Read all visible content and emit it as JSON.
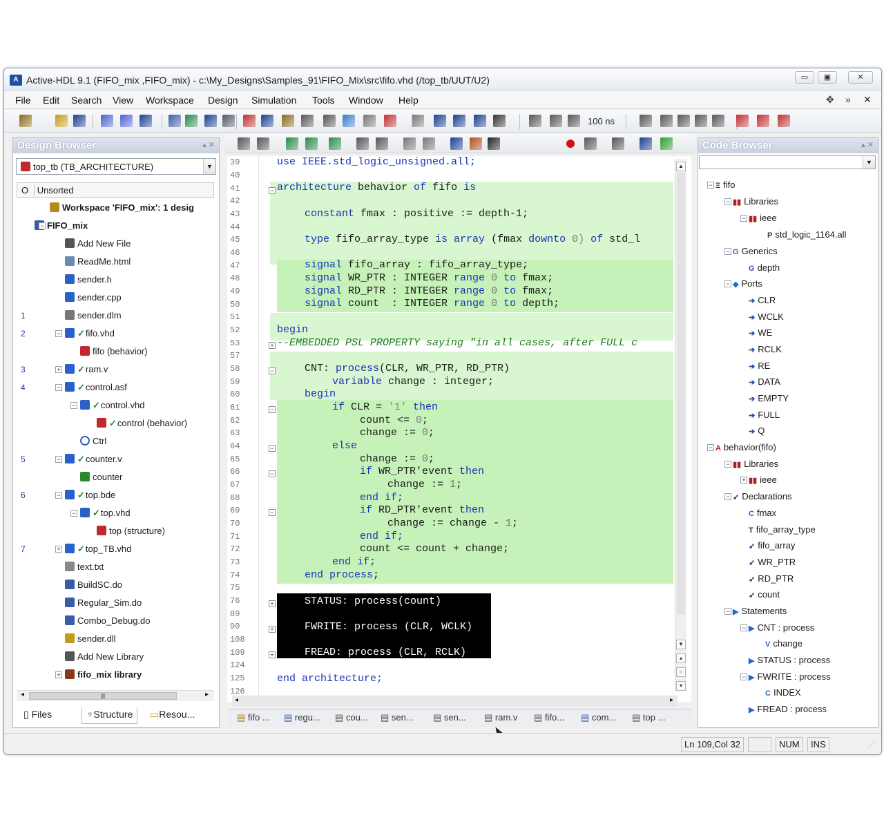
{
  "window": {
    "title": "Active-HDL 9.1 (FIFO_mix ,FIFO_mix) - c:\\My_Designs\\Samples_91\\FIFO_Mix\\src\\fifo.vhd (/top_tb/UUT/U2)",
    "controls": {
      "minimize": "▭",
      "maximize": "▣",
      "close": "✕"
    }
  },
  "menu": {
    "items": [
      "File",
      "Edit",
      "Search",
      "View",
      "Workspace",
      "Design",
      "Simulation",
      "Tools",
      "Window",
      "Help"
    ],
    "right": [
      "✥",
      "»",
      "✕"
    ]
  },
  "toolbar": {
    "sim_time": "100 ns",
    "icons": [
      "new-icon",
      "open-icon",
      "save-icon",
      "compile-icon",
      "compile-all-icon",
      "stop-compile-icon",
      "design-browser-icon",
      "hierarchy-icon",
      "console-icon",
      "find-icon",
      "waveform-icon",
      "statemachine-icon",
      "library-icon",
      "memory-icon",
      "wizard-icon",
      "watch-icon",
      "list-icon",
      "breakpoint-icon",
      "bookmark-icon",
      "run-icon",
      "run-until-icon",
      "step-icon",
      "restart-icon",
      "end-sim-icon",
      "step-back-icon",
      "step-forward-icon"
    ]
  },
  "design_browser": {
    "title": "Design Browser",
    "combo": "top_tb (TB_ARCHITECTURE)",
    "sort": "Unsorted",
    "sort_col": "O",
    "items": [
      {
        "label": "Workspace 'FIFO_mix': 1 desig",
        "bold": true,
        "num": ""
      },
      {
        "label": "FIFO_mix",
        "bold": true,
        "num": ""
      },
      {
        "label": "Add New File",
        "bold": false,
        "num": ""
      },
      {
        "label": "ReadMe.html",
        "bold": false,
        "num": ""
      },
      {
        "label": "sender.h",
        "bold": false,
        "num": ""
      },
      {
        "label": "sender.cpp",
        "bold": false,
        "num": ""
      },
      {
        "label": "sender.dlm",
        "bold": false,
        "num": "1"
      },
      {
        "label": "fifo.vhd",
        "bold": false,
        "num": "2"
      },
      {
        "label": "fifo (behavior)",
        "bold": false,
        "num": ""
      },
      {
        "label": "ram.v",
        "bold": false,
        "num": "3"
      },
      {
        "label": "control.asf",
        "bold": false,
        "num": "4"
      },
      {
        "label": "control.vhd",
        "bold": false,
        "num": ""
      },
      {
        "label": "control (behavior)",
        "bold": false,
        "num": ""
      },
      {
        "label": "Ctrl",
        "bold": false,
        "num": ""
      },
      {
        "label": "counter.v",
        "bold": false,
        "num": "5"
      },
      {
        "label": "counter",
        "bold": false,
        "num": ""
      },
      {
        "label": "top.bde",
        "bold": false,
        "num": "6"
      },
      {
        "label": "top.vhd",
        "bold": false,
        "num": ""
      },
      {
        "label": "top (structure)",
        "bold": false,
        "num": ""
      },
      {
        "label": "top_TB.vhd",
        "bold": false,
        "num": "7"
      },
      {
        "label": "text.txt",
        "bold": false,
        "num": ""
      },
      {
        "label": "BuildSC.do",
        "bold": false,
        "num": ""
      },
      {
        "label": "Regular_Sim.do",
        "bold": false,
        "num": ""
      },
      {
        "label": "Combo_Debug.do",
        "bold": false,
        "num": ""
      },
      {
        "label": "sender.dll",
        "bold": false,
        "num": ""
      },
      {
        "label": "Add New Library",
        "bold": false,
        "num": ""
      },
      {
        "label": "fifo_mix library",
        "bold": true,
        "num": ""
      }
    ],
    "scroll_thumb": "|||",
    "tabs": [
      "Files",
      "Structure",
      "Resou..."
    ]
  },
  "editor": {
    "toolbar_icons": [
      "indent-icon",
      "outdent-icon",
      "comment-icon",
      "uncomment-icon",
      "bookmark-toggle-icon",
      "expand-icon",
      "collapse-icon",
      "list-icon",
      "wrap-icon",
      "color-icon",
      "pilcrow-icon",
      "template-icon",
      "breakpoint-red-icon",
      "pause-icon",
      "stop-icon",
      "step-over-icon",
      "play-icon"
    ],
    "line_numbers": [
      "39",
      "40",
      "41",
      "42",
      "43",
      "44",
      "45",
      "46",
      "47",
      "48",
      "49",
      "50",
      "51",
      "52",
      "53",
      "57",
      "58",
      "59",
      "60",
      "61",
      "62",
      "63",
      "64",
      "65",
      "66",
      "67",
      "68",
      "69",
      "70",
      "71",
      "72",
      "73",
      "74",
      "75",
      "76",
      "89",
      "90",
      "108",
      "109",
      "124",
      "125",
      "126"
    ],
    "code": {
      "l39": "use IEEE.std_logic_unsigned.all;",
      "l41a": "architecture",
      "l41b": " behavior ",
      "l41c": "of",
      "l41d": " fifo ",
      "l41e": "is",
      "l43a": "constant",
      "l43b": " fmax : ",
      "l43c": "positive",
      "l43d": " := depth-1;",
      "l45a": "type",
      "l45b": " fifo_array_type ",
      "l45c": "is array",
      "l45d": " (fmax ",
      "l45e": "downto",
      "l45f": " 0) ",
      "l45g": "of",
      "l45h": " std_l",
      "l47a": "signal",
      "l47b": " fifo_array : fifo_array_type;",
      "l48a": "signal",
      "l48b": " WR_PTR : ",
      "l48c": "INTEGER",
      "l48d": " range ",
      "l48e": "0",
      "l48f": " to ",
      "l48g": "fmax;",
      "l49a": "signal",
      "l49b": " RD_PTR : ",
      "l49c": "INTEGER",
      "l49d": " range ",
      "l49e": "0",
      "l49f": " to ",
      "l49g": "fmax;",
      "l50a": "signal",
      "l50b": " count  : ",
      "l50c": "INTEGER",
      "l50d": " range ",
      "l50e": "0",
      "l50f": " to ",
      "l50g": "depth;",
      "l52": "begin",
      "l53": "--EMBEDDED PSL PROPERTY saying \"in all cases, after FULL c",
      "l58a": "CNT: ",
      "l58b": "process",
      "l58c": "(CLR, WR_PTR, RD_PTR)",
      "l59a": "variable",
      "l59b": " change : ",
      "l59c": "integer",
      "l59d": ";",
      "l60": "begin",
      "l61a": "if",
      "l61b": " CLR = ",
      "l61c": "'1'",
      "l61d": " then",
      "l62a": "count <= ",
      "l62b": "0",
      "l62c": ";",
      "l63a": "change := ",
      "l63b": "0",
      "l63c": ";",
      "l64": "else",
      "l65a": "change := ",
      "l65b": "0",
      "l65c": ";",
      "l66a": "if",
      "l66b": " WR_PTR'event ",
      "l66c": "then",
      "l67a": "change := ",
      "l67b": "1",
      "l67c": ";",
      "l68": "end if;",
      "l69a": "if",
      "l69b": " RD_PTR'event ",
      "l69c": "then",
      "l70a": "change := change - ",
      "l70b": "1",
      "l70c": ";",
      "l71": "end if;",
      "l72": "count <= count + change;",
      "l73": "end if;",
      "l74a": "end process",
      "l74b": ";",
      "l76": "STATUS: process(count)",
      "l90": "FWRITE: process (CLR, WCLK)",
      "l109": "FREAD: process (CLR, RCLK)",
      "l125": "end architecture;"
    },
    "tabs": [
      "fifo ...",
      "regu...",
      "cou...",
      "sen...",
      "sen...",
      "ram.v",
      "fifo...",
      "com...",
      "top ..."
    ]
  },
  "code_browser": {
    "title": "Code Browser",
    "items": [
      {
        "label": "fifo",
        "icon": "Ξ"
      },
      {
        "label": "Libraries",
        "icon": "▮▮"
      },
      {
        "label": "ieee",
        "icon": "▮▮"
      },
      {
        "label": "std_logic_1164.all",
        "icon": "P"
      },
      {
        "label": "Generics",
        "icon": "G"
      },
      {
        "label": "depth",
        "icon": "G"
      },
      {
        "label": "Ports",
        "icon": "◆"
      },
      {
        "label": "CLR",
        "icon": "➔"
      },
      {
        "label": "WCLK",
        "icon": "➔"
      },
      {
        "label": "WE",
        "icon": "➔"
      },
      {
        "label": "RCLK",
        "icon": "➔"
      },
      {
        "label": "RE",
        "icon": "➔"
      },
      {
        "label": "DATA",
        "icon": "➔"
      },
      {
        "label": "EMPTY",
        "icon": "➔"
      },
      {
        "label": "FULL",
        "icon": "➔"
      },
      {
        "label": "Q",
        "icon": "➔"
      },
      {
        "label": "behavior(fifo)",
        "icon": "A"
      },
      {
        "label": "Libraries",
        "icon": "▮▮"
      },
      {
        "label": "ieee",
        "icon": "▮▮"
      },
      {
        "label": "Declarations",
        "icon": "➶"
      },
      {
        "label": "fmax",
        "icon": "C"
      },
      {
        "label": "fifo_array_type",
        "icon": "T"
      },
      {
        "label": "fifo_array",
        "icon": "➶"
      },
      {
        "label": "WR_PTR",
        "icon": "➶"
      },
      {
        "label": "RD_PTR",
        "icon": "➶"
      },
      {
        "label": "count",
        "icon": "➶"
      },
      {
        "label": "Statements",
        "icon": "▶"
      },
      {
        "label": "CNT : process",
        "icon": "▶"
      },
      {
        "label": "change",
        "icon": "V"
      },
      {
        "label": "STATUS : process",
        "icon": "▶"
      },
      {
        "label": "FWRITE : process",
        "icon": "▶"
      },
      {
        "label": "INDEX",
        "icon": "C"
      },
      {
        "label": "FREAD : process",
        "icon": "▶"
      }
    ]
  },
  "status": {
    "position": "Ln 109,Col 32",
    "num": "NUM",
    "ins": "INS"
  }
}
